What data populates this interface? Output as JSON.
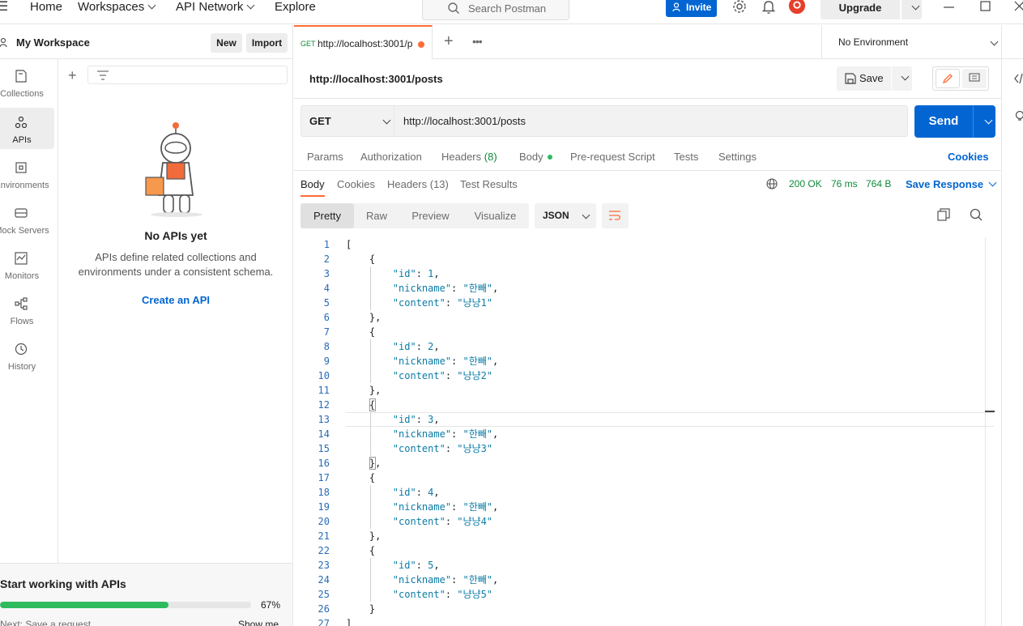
{
  "topbar": {
    "nav": [
      "Home",
      "Workspaces",
      "API Network",
      "Explore"
    ],
    "search_placeholder": "Search Postman",
    "invite_label": "Invite",
    "upgrade_label": "Upgrade"
  },
  "sidebar": {
    "workspace_title": "My Workspace",
    "new_label": "New",
    "import_label": "Import",
    "rail": [
      {
        "label": "Collections",
        "icon": "collections-icon"
      },
      {
        "label": "APIs",
        "icon": "apis-icon",
        "active": true
      },
      {
        "label": "Environments",
        "icon": "environments-icon"
      },
      {
        "label": "Mock Servers",
        "icon": "mock-servers-icon"
      },
      {
        "label": "Monitors",
        "icon": "monitors-icon"
      },
      {
        "label": "Flows",
        "icon": "flows-icon"
      },
      {
        "label": "History",
        "icon": "history-icon"
      }
    ],
    "empty_title": "No APIs yet",
    "empty_desc": "APIs define related collections and environments under a consistent schema.",
    "empty_link": "Create an API",
    "onboarding": {
      "title": "Start working with APIs",
      "progress_percent": 67,
      "progress_label": "67%",
      "next": "Next: Save a request.",
      "show": "Show me"
    }
  },
  "tab": {
    "method": "GET",
    "url": "http://localhost:3001/p"
  },
  "environment": "No Environment",
  "request": {
    "title": "http://localhost:3001/posts",
    "save_label": "Save",
    "method": "GET",
    "url": "http://localhost:3001/posts",
    "send_label": "Send",
    "tabs": [
      {
        "label": "Params"
      },
      {
        "label": "Authorization"
      },
      {
        "label": "Headers",
        "count": "(8)"
      },
      {
        "label": "Body"
      },
      {
        "label": "Pre-request Script"
      },
      {
        "label": "Tests"
      },
      {
        "label": "Settings"
      }
    ],
    "cookies_label": "Cookies"
  },
  "response": {
    "tabs": [
      "Body",
      "Cookies",
      "Headers (13)",
      "Test Results"
    ],
    "status": "200 OK",
    "time": "76 ms",
    "size": "764 B",
    "save_response": "Save Response",
    "views": [
      "Pretty",
      "Raw",
      "Preview",
      "Visualize"
    ],
    "format": "JSON",
    "body_lines": [
      "[",
      "    {",
      "        \"id\": 1,",
      "        \"nickname\": \"한빼\",",
      "        \"content\": \"냥냥1\"",
      "    },",
      "    {",
      "        \"id\": 2,",
      "        \"nickname\": \"한빼\",",
      "        \"content\": \"냥냥2\"",
      "    },",
      "    {",
      "        \"id\": 3,",
      "        \"nickname\": \"한빼\",",
      "        \"content\": \"냥냥3\"",
      "    },",
      "    {",
      "        \"id\": 4,",
      "        \"nickname\": \"한빼\",",
      "        \"content\": \"냥냥4\"",
      "    },",
      "    {",
      "        \"id\": 5,",
      "        \"nickname\": \"한빼\",",
      "        \"content\": \"냥냥5\"",
      "    }",
      "]"
    ]
  },
  "colors": {
    "accent": "#ff6c37",
    "primary": "#0265d2",
    "success": "#0f8a3c",
    "progress": "#2dbb5d"
  }
}
